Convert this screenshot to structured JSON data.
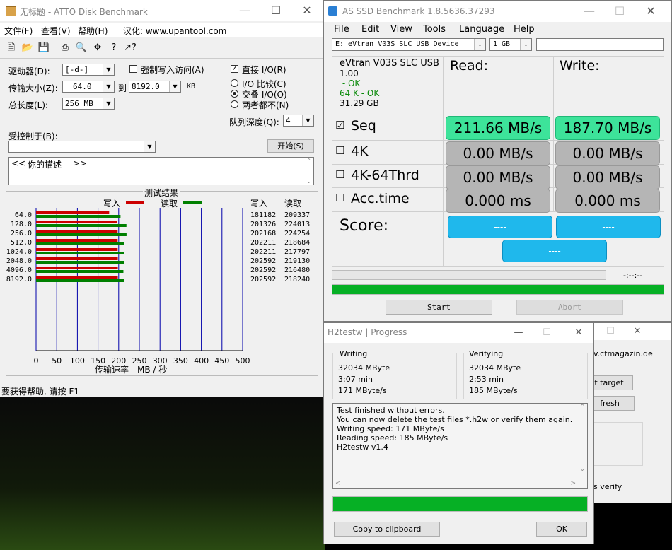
{
  "colors": {
    "write_bar": "#cc0000",
    "read_bar": "#008000",
    "progress": "#06b025",
    "seq_green": "#3de39a",
    "score_blue": "#1fb8ec"
  },
  "atto": {
    "title": "无标题 - ATTO Disk Benchmark",
    "menu": [
      "文件(F)",
      "查看(V)",
      "帮助(H)"
    ],
    "ad": "汉化: www.upantool.com",
    "toolbar_icons": [
      "new-icon",
      "open-icon",
      "save-icon",
      "print-icon",
      "print-preview-icon",
      "move-icon",
      "help-icon",
      "context-help-icon"
    ],
    "drive_label": "驱动器(D):",
    "drive_value": "[-d-]",
    "transfer_label": "传输大小(Z):",
    "transfer_from": "64.0",
    "to_label": "到",
    "transfer_to": "8192.0",
    "kb_label": "KB",
    "length_label": "总长度(L):",
    "length_value": "256 MB",
    "force_write": "强制写入访问(A)",
    "direct_io": "直接 I/O(R)",
    "io_compare": "I/O 比较(C)",
    "overlapped_io": "交叠 I/O(O)",
    "neither": "两者都不(N)",
    "queue_label": "队列深度(Q):",
    "queue_value": "4",
    "controlled_label": "受控制于(B):",
    "start_button": "开始(S)",
    "desc_left": "<<",
    "desc_text": "你的描述",
    "desc_right": ">>",
    "results_title": "测试结果",
    "legend_write": "写入",
    "legend_read": "读取",
    "col_write": "写入",
    "col_read": "读取",
    "x_ticks": [
      "0",
      "50",
      "100",
      "150",
      "200",
      "250",
      "300",
      "350",
      "400",
      "450",
      "500"
    ],
    "x_axis_label": "传输速率 - MB / 秒",
    "status": "要获得帮助, 请按 F1"
  },
  "chart_data": {
    "type": "bar",
    "orientation": "horizontal",
    "title": "测试结果",
    "xlabel": "传输速率 - MB / 秒",
    "xlim": [
      0,
      500
    ],
    "categories": [
      "64.0",
      "128.0",
      "256.0",
      "512.0",
      "1024.0",
      "2048.0",
      "4096.0",
      "8192.0"
    ],
    "series": [
      {
        "name": "写入",
        "values": [
          181182,
          201326,
          202168,
          202211,
          202211,
          202592,
          202592,
          202592
        ]
      },
      {
        "name": "读取",
        "values": [
          209337,
          224013,
          224254,
          218684,
          217797,
          219130,
          216480,
          218240
        ]
      }
    ]
  },
  "asssd": {
    "title": "AS SSD Benchmark 1.8.5636.37293",
    "menu": [
      "File",
      "Edit",
      "View",
      "Tools",
      "Language",
      "Help"
    ],
    "drive_select": "E: eVtran V03S SLC USB Device",
    "size_select": "1 GB",
    "info": [
      "eVtran V03S SLC USB",
      "1.00",
      " - OK",
      "64 K - OK",
      "31.29 GB"
    ],
    "read_header": "Read:",
    "write_header": "Write:",
    "rows": [
      {
        "label": "Seq",
        "read": "211.66 MB/s",
        "write": "187.70 MB/s",
        "checked": "☑"
      },
      {
        "label": "4K",
        "read": "0.00 MB/s",
        "write": "0.00 MB/s",
        "checked": "☐"
      },
      {
        "label": "4K-64Thrd",
        "read": "0.00 MB/s",
        "write": "0.00 MB/s",
        "checked": "☐"
      },
      {
        "label": "Acc.time",
        "read": "0.000 ms",
        "write": "0.000 ms",
        "checked": "☐"
      }
    ],
    "score_label": "Score:",
    "score_read": "----",
    "score_write": "----",
    "score_total": "----",
    "time_display": "-:--:--",
    "progress_fraction": 1.0,
    "start_button": "Start",
    "abort_button": "Abort"
  },
  "h2": {
    "title": "H2testw | Progress",
    "writing_title": "Writing",
    "writing": [
      "32034 MByte",
      "3:07 min",
      "171 MByte/s"
    ],
    "verifying_title": "Verifying",
    "verifying": [
      "32034 MByte",
      "2:53 min",
      "185 MByte/s"
    ],
    "log": [
      "Test finished without errors.",
      "You can now delete the test files *.h2w or verify them again.",
      "Writing speed: 171 MByte/s",
      "Reading speed: 185 MByte/s",
      "H2testw v1.4"
    ],
    "progress_fraction": 1.0,
    "copy_button": "Copy to clipboard",
    "ok_button": "OK"
  },
  "h2bg": {
    "site": "v.ctmagazin.de",
    "target_btn": "t target",
    "refresh_btn": "fresh",
    "verify": "s verify"
  }
}
